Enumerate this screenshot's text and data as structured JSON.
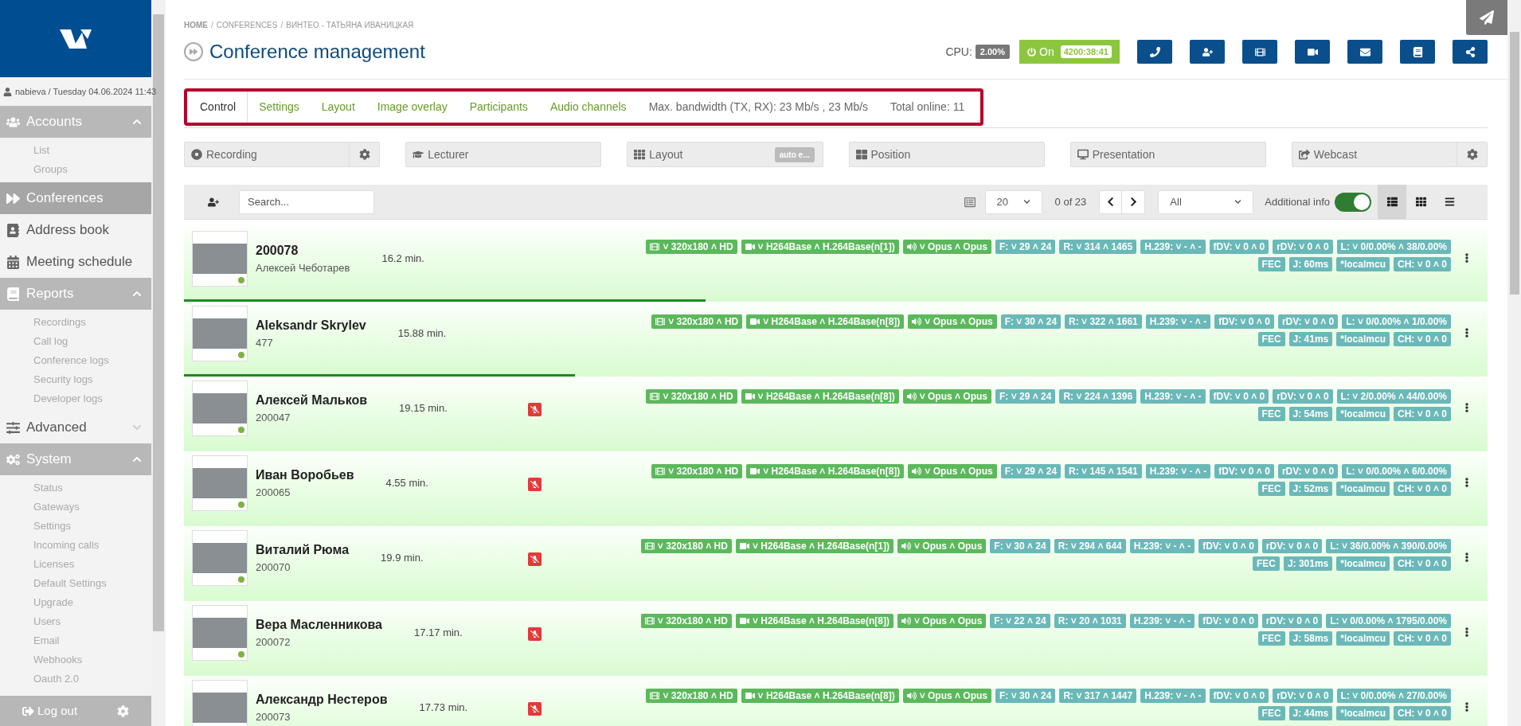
{
  "sidebar": {
    "user": "nabieva / Tuesday 04.06.2024 11:43",
    "items": [
      {
        "label": "Accounts",
        "kind": "section",
        "expanded": true,
        "selected": false,
        "children": [
          "List",
          "Groups"
        ]
      },
      {
        "label": "Conferences",
        "kind": "link",
        "selected": true
      },
      {
        "label": "Address book",
        "kind": "link",
        "selected": false
      },
      {
        "label": "Meeting schedule",
        "kind": "link",
        "selected": false
      },
      {
        "label": "Reports",
        "kind": "section",
        "expanded": true,
        "selected": false,
        "children": [
          "Recordings",
          "Call log",
          "Conference logs",
          "Security logs",
          "Developer logs"
        ]
      },
      {
        "label": "Advanced",
        "kind": "section",
        "expanded": false,
        "selected": false
      },
      {
        "label": "System",
        "kind": "section",
        "expanded": true,
        "selected": false,
        "children": [
          "Status",
          "Gateways",
          "Settings",
          "Incoming calls",
          "Licenses",
          "Default Settings",
          "Upgrade",
          "Users",
          "Email",
          "Webhooks",
          "Oauth 2.0"
        ]
      }
    ],
    "logout": "Log out"
  },
  "breadcrumb": [
    {
      "kind": "home",
      "text": "HOME"
    },
    {
      "kind": "separator",
      "text": "/"
    },
    {
      "kind": "link",
      "text": "CONFERENCES"
    },
    {
      "kind": "separator",
      "text": "/"
    },
    {
      "kind": "link",
      "text": "ВИНТЕО - ТАТЬЯНА ИВАНИЦКАЯ"
    }
  ],
  "title": "Conference management",
  "cpu": {
    "label": "CPU:",
    "value": "2.00%"
  },
  "power": {
    "label": "On",
    "on": true,
    "time": "4200:38:41"
  },
  "tabs": [
    {
      "label": "Control",
      "selected": true
    },
    {
      "label": "Settings",
      "selected": false
    },
    {
      "label": "Layout",
      "selected": false
    },
    {
      "label": "Image overlay",
      "selected": false
    },
    {
      "label": "Participants",
      "selected": false
    },
    {
      "label": "Audio channels",
      "selected": false
    }
  ],
  "tab_info": [
    "Max. bandwidth (TX, RX): 23 Mb/s , 23 Mb/s",
    "Total online: 11"
  ],
  "controls": [
    {
      "label": "Recording",
      "settings": true
    },
    {
      "label": "Lecturer",
      "settings": false
    },
    {
      "label": "Layout",
      "settings": false,
      "badge": "auto e..."
    },
    {
      "label": "Position",
      "settings": false
    },
    {
      "label": "Presentation",
      "settings": false
    },
    {
      "label": "Webcast",
      "settings": true
    }
  ],
  "toolbar": {
    "search_placeholder": "Search...",
    "page_size": "20",
    "count": "0 of 23",
    "filter": "All",
    "additional_info": {
      "label": "Additional info",
      "on": true
    },
    "views": [
      {
        "selected": true
      },
      {
        "selected": false
      },
      {
        "selected": false
      }
    ]
  },
  "rows": [
    {
      "name": "200078",
      "sub": "Алексей Чеботарев",
      "duration": "16.2 min.",
      "muted": false,
      "level": 0.4,
      "badges": [
        {
          "kind": "video",
          "text": "˅ 320x180 ˄ HD"
        },
        {
          "kind": "codec",
          "text": "˅ H264Base ˄ H.264Base(n[1])"
        },
        {
          "kind": "audio",
          "text": "˅ Opus ˄ Opus"
        },
        {
          "kind": "stat",
          "text": "F: ˅ 29 ˄ 24"
        },
        {
          "kind": "stat",
          "text": "R: ˅ 314 ˄ 1465"
        },
        {
          "kind": "stat",
          "text": "H.239: ˅ - ˄ -"
        },
        {
          "kind": "stat",
          "text": "fDV: ˅ 0 ˄ 0"
        },
        {
          "kind": "stat",
          "text": "rDV: ˅ 0 ˄ 0"
        },
        {
          "kind": "stat",
          "text": "L: ˅ 0/0.00% ˄ 38/0.00%"
        }
      ],
      "extra": [
        "FEC",
        "J: 60ms",
        "*localmcu",
        "CH: ˅ 0 ˄ 0"
      ]
    },
    {
      "name": "Aleksandr Skrylev",
      "sub": "477",
      "duration": "15.88 min.",
      "muted": false,
      "level": 0.3,
      "badges": [
        {
          "kind": "video",
          "text": "˅ 320x180 ˄ HD"
        },
        {
          "kind": "codec",
          "text": "˅ H264Base ˄ H.264Base(n[8])"
        },
        {
          "kind": "audio",
          "text": "˅ Opus ˄ Opus"
        },
        {
          "kind": "stat",
          "text": "F: ˅ 30 ˄ 24"
        },
        {
          "kind": "stat",
          "text": "R: ˅ 322 ˄ 1661"
        },
        {
          "kind": "stat",
          "text": "H.239: ˅ - ˄ -"
        },
        {
          "kind": "stat",
          "text": "fDV: ˅ 0 ˄ 0"
        },
        {
          "kind": "stat",
          "text": "rDV: ˅ 0 ˄ 0"
        },
        {
          "kind": "stat",
          "text": "L: ˅ 0/0.00% ˄ 1/0.00%"
        }
      ],
      "extra": [
        "FEC",
        "J: 41ms",
        "*localmcu",
        "CH: ˅ 0 ˄ 0"
      ]
    },
    {
      "name": "Алексей Мальков",
      "sub": "200047",
      "duration": "19.15 min.",
      "muted": true,
      "level": 0,
      "badges": [
        {
          "kind": "video",
          "text": "˅ 320x180 ˄ HD"
        },
        {
          "kind": "codec",
          "text": "˅ H264Base ˄ H.264Base(n[8])"
        },
        {
          "kind": "audio",
          "text": "˅ Opus ˄ Opus"
        },
        {
          "kind": "stat",
          "text": "F: ˅ 29 ˄ 24"
        },
        {
          "kind": "stat",
          "text": "R: ˅ 224 ˄ 1396"
        },
        {
          "kind": "stat",
          "text": "H.239: ˅ - ˄ -"
        },
        {
          "kind": "stat",
          "text": "fDV: ˅ 0 ˄ 0"
        },
        {
          "kind": "stat",
          "text": "rDV: ˅ 0 ˄ 0"
        },
        {
          "kind": "stat",
          "text": "L: ˅ 2/0.00% ˄ 44/0.00%"
        }
      ],
      "extra": [
        "FEC",
        "J: 54ms",
        "*localmcu",
        "CH: ˅ 0 ˄ 0"
      ]
    },
    {
      "name": "Иван Воробьев",
      "sub": "200065",
      "duration": "4.55 min.",
      "muted": true,
      "level": 0,
      "badges": [
        {
          "kind": "video",
          "text": "˅ 320x180 ˄ HD"
        },
        {
          "kind": "codec",
          "text": "˅ H264Base ˄ H.264Base(n[8])"
        },
        {
          "kind": "audio",
          "text": "˅ Opus ˄ Opus"
        },
        {
          "kind": "stat",
          "text": "F: ˅ 29 ˄ 24"
        },
        {
          "kind": "stat",
          "text": "R: ˅ 145 ˄ 1541"
        },
        {
          "kind": "stat",
          "text": "H.239: ˅ - ˄ -"
        },
        {
          "kind": "stat",
          "text": "fDV: ˅ 0 ˄ 0"
        },
        {
          "kind": "stat",
          "text": "rDV: ˅ 0 ˄ 0"
        },
        {
          "kind": "stat",
          "text": "L: ˅ 0/0.00% ˄ 6/0.00%"
        }
      ],
      "extra": [
        "FEC",
        "J: 52ms",
        "*localmcu",
        "CH: ˅ 0 ˄ 0"
      ]
    },
    {
      "name": "Виталий Рюма",
      "sub": "200070",
      "duration": "19.9 min.",
      "muted": true,
      "level": 0,
      "badges": [
        {
          "kind": "video",
          "text": "˅ 320x180 ˄ HD"
        },
        {
          "kind": "codec",
          "text": "˅ H264Base ˄ H.264Base(n[1])"
        },
        {
          "kind": "audio",
          "text": "˅ Opus ˄ Opus"
        },
        {
          "kind": "stat",
          "text": "F: ˅ 30 ˄ 24"
        },
        {
          "kind": "stat",
          "text": "R: ˅ 294 ˄ 644"
        },
        {
          "kind": "stat",
          "text": "H.239: ˅ - ˄ -"
        },
        {
          "kind": "stat",
          "text": "fDV: ˅ 0 ˄ 0"
        },
        {
          "kind": "stat",
          "text": "rDV: ˅ 0 ˄ 0"
        },
        {
          "kind": "stat",
          "text": "L: ˅ 36/0.00% ˄ 390/0.00%"
        }
      ],
      "extra": [
        "FEC",
        "J: 301ms",
        "*localmcu",
        "CH: ˅ 0 ˄ 0"
      ]
    },
    {
      "name": "Вера Масленникова",
      "sub": "200072",
      "duration": "17.17 min.",
      "muted": true,
      "level": 0,
      "badges": [
        {
          "kind": "video",
          "text": "˅ 320x180 ˄ HD"
        },
        {
          "kind": "codec",
          "text": "˅ H264Base ˄ H.264Base(n[8])"
        },
        {
          "kind": "audio",
          "text": "˅ Opus ˄ Opus"
        },
        {
          "kind": "stat",
          "text": "F: ˅ 22 ˄ 24"
        },
        {
          "kind": "stat",
          "text": "R: ˅ 20 ˄ 1031"
        },
        {
          "kind": "stat",
          "text": "H.239: ˅ - ˄ -"
        },
        {
          "kind": "stat",
          "text": "fDV: ˅ 0 ˄ 0"
        },
        {
          "kind": "stat",
          "text": "rDV: ˅ 0 ˄ 0"
        },
        {
          "kind": "stat",
          "text": "L: ˅ 0/0.00% ˄ 1795/0.00%"
        }
      ],
      "extra": [
        "FEC",
        "J: 58ms",
        "*localmcu",
        "CH: ˅ 0 ˄ 0"
      ]
    },
    {
      "name": "Александр Нестеров",
      "sub": "200073",
      "duration": "17.73 min.",
      "muted": true,
      "level": 0,
      "badges": [
        {
          "kind": "video",
          "text": "˅ 320x180 ˄ HD"
        },
        {
          "kind": "codec",
          "text": "˅ H264Base ˄ H.264Base(n[8])"
        },
        {
          "kind": "audio",
          "text": "˅ Opus ˄ Opus"
        },
        {
          "kind": "stat",
          "text": "F: ˅ 30 ˄ 24"
        },
        {
          "kind": "stat",
          "text": "R: ˅ 317 ˄ 1447"
        },
        {
          "kind": "stat",
          "text": "H.239: ˅ - ˄ -"
        },
        {
          "kind": "stat",
          "text": "fDV: ˅ 0 ˄ 0"
        },
        {
          "kind": "stat",
          "text": "rDV: ˅ 0 ˄ 0"
        },
        {
          "kind": "stat",
          "text": "L: ˅ 0/0.00% ˄ 27/0.00%"
        }
      ],
      "extra": [
        "FEC",
        "J: 44ms",
        "*localmcu",
        "CH: ˅ 0 ˄ 0"
      ]
    }
  ]
}
